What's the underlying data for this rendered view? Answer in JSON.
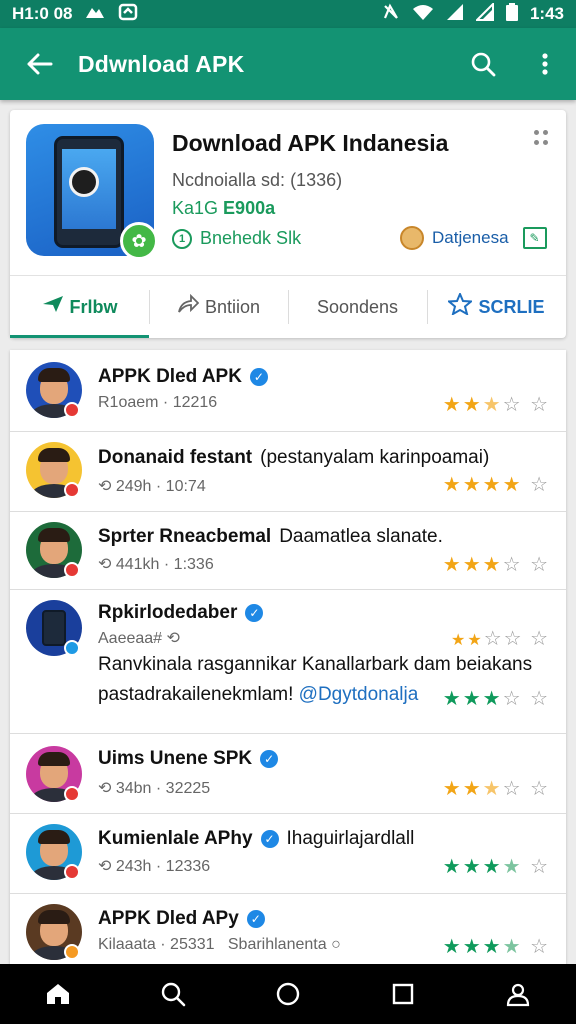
{
  "status_bar": {
    "time": "H1:0 08",
    "time_right": "1:43"
  },
  "app_bar": {
    "title": "Ddwnload APK"
  },
  "app_card": {
    "title": "Download APK Indanesia",
    "subtitle": "Ncdnoialla sd: (1336)",
    "size_label": "Ka1G",
    "size_value": "E900a",
    "info_text": "Bnehedk Slk",
    "developer": "Datjenesa",
    "tabs": [
      {
        "label": "Frlbw",
        "icon": "send-icon"
      },
      {
        "label": "Bntiion",
        "icon": "share-icon"
      },
      {
        "label": "Soondens",
        "icon": ""
      },
      {
        "label": "SCRLIE",
        "icon": "star-icon"
      }
    ]
  },
  "colors": {
    "accent": "#139373",
    "status_bar": "#0e7e63",
    "link": "#1e6fc0",
    "star_orange": "#f2a516",
    "star_green": "#0f9a5c"
  },
  "list": [
    {
      "name": "APPK Dled APK",
      "verified": true,
      "meta": "R1oaem · 12216",
      "rating": 2.5,
      "stars_color": "orange",
      "avatar_bg": "#1f4fb8",
      "badge_color": "#e53935"
    },
    {
      "name": "Donanaid festant",
      "name_extra": "(pestanyalam karinpoamai)",
      "verified": false,
      "meta": "249h · 10:74",
      "rating": 4,
      "stars_color": "orange",
      "avatar_bg": "#f5c331",
      "badge_color": "#e53935"
    },
    {
      "name": "Sprter Rneacbemal",
      "name_extra": "Daamatlea slanate.",
      "verified": false,
      "meta": "441kh · 1:336",
      "rating": 3,
      "stars_color": "orange",
      "avatar_bg": "#1d6b3a",
      "badge_color": "#e53935"
    },
    {
      "name": "Rpkirlodedaber",
      "verified": true,
      "meta": "Aaeeaa#",
      "rating": 2,
      "stars_color": "orange",
      "avatar_bg": "#1a3f9c",
      "badge_color": "#1e9ae5",
      "description": "Ranvkinala rasgannikar Kanallarbark dam beiakans pastadrakailenekmlam!",
      "mention": "@Dgytdonalja",
      "rating_secondary": 3,
      "stars_color_secondary": "green"
    },
    {
      "name": "Uims Unene SPK",
      "verified": true,
      "meta": "34bn · 32225",
      "rating": 2.5,
      "stars_color": "orange",
      "avatar_bg": "#c83aa0",
      "badge_color": "#e53935"
    },
    {
      "name": "Kumienlale APhy",
      "name_extra": "Ihaguirlajardlall",
      "verified": true,
      "meta": "243h · 12336",
      "rating": 3.5,
      "stars_color": "green",
      "avatar_bg": "#1e9ad6",
      "badge_color": "#e53935"
    },
    {
      "name": "APPK Dled APy",
      "verified": true,
      "meta": "Kilaaata · 25331",
      "meta_extra": "Sbarihlanenta",
      "rating": 3.5,
      "stars_color": "green",
      "avatar_bg": "#5a3a22",
      "badge_color": "#f59a23"
    }
  ],
  "nav_bar": {
    "items": [
      "home-icon",
      "search-icon",
      "circle-icon",
      "square-icon",
      "profile-icon"
    ]
  }
}
